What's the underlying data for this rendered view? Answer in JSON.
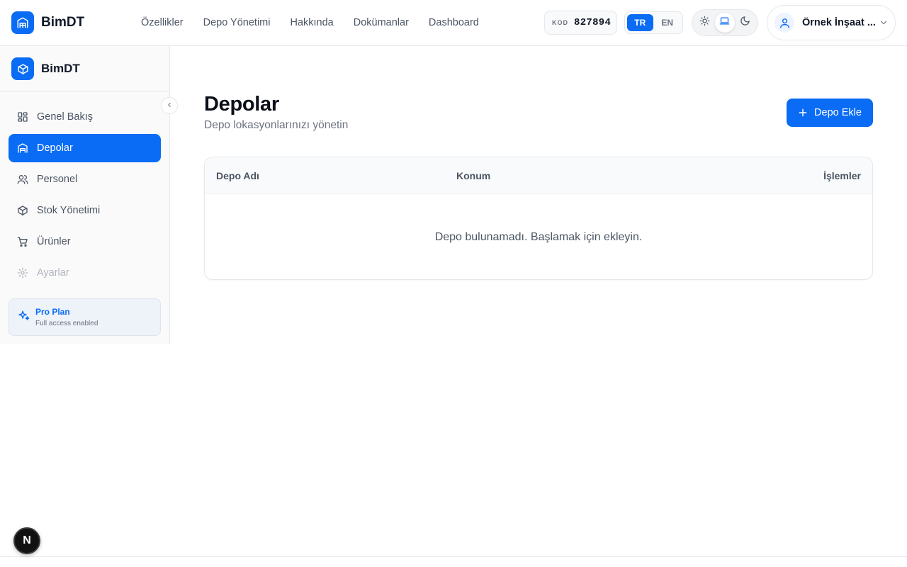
{
  "app": {
    "name": "BimDT"
  },
  "nav": {
    "items": [
      "Özellikler",
      "Depo Yönetimi",
      "Hakkında",
      "Dokümanlar",
      "Dashboard"
    ]
  },
  "kod": {
    "label": "KOD",
    "value": "827894"
  },
  "language": {
    "options": [
      "TR",
      "EN"
    ],
    "selected": "TR"
  },
  "theme": {
    "options": [
      "sun-icon",
      "laptop-icon",
      "moon-icon"
    ],
    "selected": "laptop-icon"
  },
  "user": {
    "name": "Örnek İnşaat ..."
  },
  "sidebar": {
    "brand": "BimDT",
    "items": [
      {
        "label": "Genel Bakış",
        "icon": "dashboard-grid-icon",
        "state": "normal"
      },
      {
        "label": "Depolar",
        "icon": "warehouse-icon",
        "state": "active"
      },
      {
        "label": "Personel",
        "icon": "users-icon",
        "state": "normal"
      },
      {
        "label": "Stok Yönetimi",
        "icon": "package-icon",
        "state": "normal"
      },
      {
        "label": "Ürünler",
        "icon": "shopping-cart-icon",
        "state": "normal"
      },
      {
        "label": "Ayarlar",
        "icon": "settings-icon",
        "state": "disabled"
      }
    ],
    "plan": {
      "title": "Pro Plan",
      "subtitle": "Full access enabled"
    }
  },
  "main": {
    "title": "Depolar",
    "subtitle": "Depo lokasyonlarınızı yönetin",
    "add_button": "Depo Ekle",
    "table": {
      "columns": [
        "Depo Adı",
        "Konum",
        "İşlemler"
      ],
      "rows": [],
      "empty_message": "Depo bulunamadı. Başlamak için ekleyin."
    }
  },
  "dev_badge": {
    "label": "N"
  },
  "colors": {
    "accent": "#0a6cf5",
    "text": "#111827",
    "muted": "#6b7280",
    "border": "#e5e7eb"
  }
}
